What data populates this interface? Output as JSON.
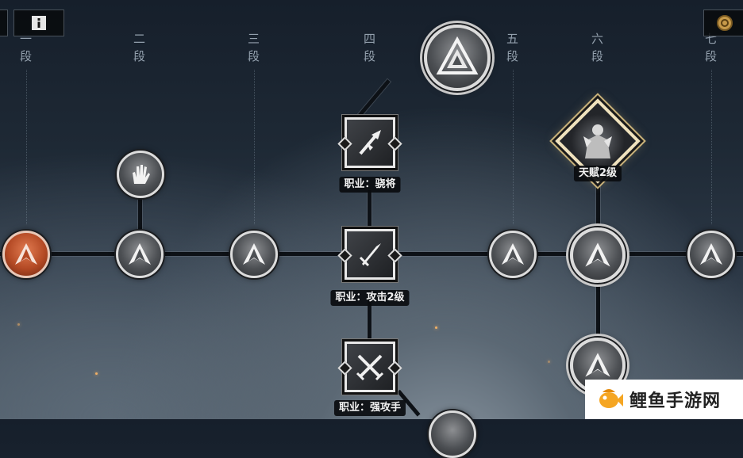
{
  "stages": [
    {
      "label": "一",
      "suffix": "段"
    },
    {
      "label": "二",
      "suffix": "段"
    },
    {
      "label": "三",
      "suffix": "段"
    },
    {
      "label": "四",
      "suffix": "段"
    },
    {
      "label": "五",
      "suffix": "段"
    },
    {
      "label": "六",
      "suffix": "段"
    },
    {
      "label": "七",
      "suffix": "段"
    }
  ],
  "nodes": {
    "class_warlord": {
      "label": "职业：骁将",
      "icon": "halberd-icon"
    },
    "class_attack": {
      "label": "职业：攻击2级",
      "icon": "sword-icon"
    },
    "class_strong": {
      "label": "职业：强攻手",
      "icon": "crossed-swords-icon"
    },
    "talent": {
      "label": "天赋2级",
      "icon": "warrior-portrait-icon"
    },
    "top_emblem": {
      "icon": "triangle-emblem-icon"
    },
    "hand_node": {
      "icon": "hand-icon"
    }
  },
  "hud": {
    "info_icon": "info-icon",
    "currency_icon": "coin-icon"
  },
  "watermark": {
    "text": "鲤鱼手游网",
    "icon": "fish-logo-icon",
    "accent": "#f5a623"
  },
  "colors": {
    "fire_node": "#b44a25",
    "talent_border": "#f0e2bd"
  }
}
